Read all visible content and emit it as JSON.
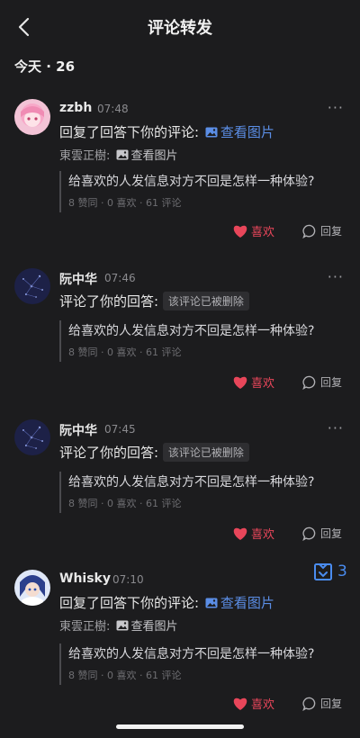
{
  "header": {
    "title": "评论转发"
  },
  "section": {
    "date_label": "今天 · 26"
  },
  "items": [
    {
      "user": "zzbh",
      "time": "07:48",
      "action_prefix": "回复了回答下你的评论: ",
      "action_link": "查看图片",
      "quote_user": "東雲正樹: ",
      "quote_link": "查看图片",
      "card_title": "给喜欢的人发信息对方不回是怎样一种体验?",
      "card_stats": "8 赞同 · 0 喜欢 · 61 评论",
      "like_label": "喜欢",
      "reply_label": "回复",
      "more": "···"
    },
    {
      "user": "阮中华",
      "time": "07:46",
      "action_prefix": "评论了你的回答: ",
      "deleted_label": "该评论已被删除",
      "card_title": "给喜欢的人发信息对方不回是怎样一种体验?",
      "card_stats": "8 赞同 · 0 喜欢 · 61 评论",
      "like_label": "喜欢",
      "reply_label": "回复",
      "more": "···"
    },
    {
      "user": "阮中华",
      "time": "07:45",
      "action_prefix": "评论了你的回答: ",
      "deleted_label": "该评论已被删除",
      "card_title": "给喜欢的人发信息对方不回是怎样一种体验?",
      "card_stats": "8 赞同 · 0 喜欢 · 61 评论",
      "like_label": "喜欢",
      "reply_label": "回复",
      "more": "···"
    },
    {
      "user": "Whisky",
      "time": "07:10",
      "action_prefix": "回复了回答下你的评论: ",
      "action_link": "查看图片",
      "quote_user": "東雲正樹: ",
      "quote_link": "查看图片",
      "card_title": "给喜欢的人发信息对方不回是怎样一种体验?",
      "card_stats": "8 赞同 · 0 喜欢 · 61 评论",
      "like_label": "喜欢",
      "reply_label": "回复"
    }
  ],
  "floating": {
    "count": "3"
  },
  "colors": {
    "background": "#1c1c1e",
    "link": "#5b8ee6",
    "like": "#e8465a",
    "badge": "#4a8cf0"
  },
  "icons": [
    "back-arrow-icon",
    "image-icon",
    "heart-icon",
    "reply-bubble-icon",
    "inbox-collapse-icon",
    "more-dots-icon"
  ]
}
